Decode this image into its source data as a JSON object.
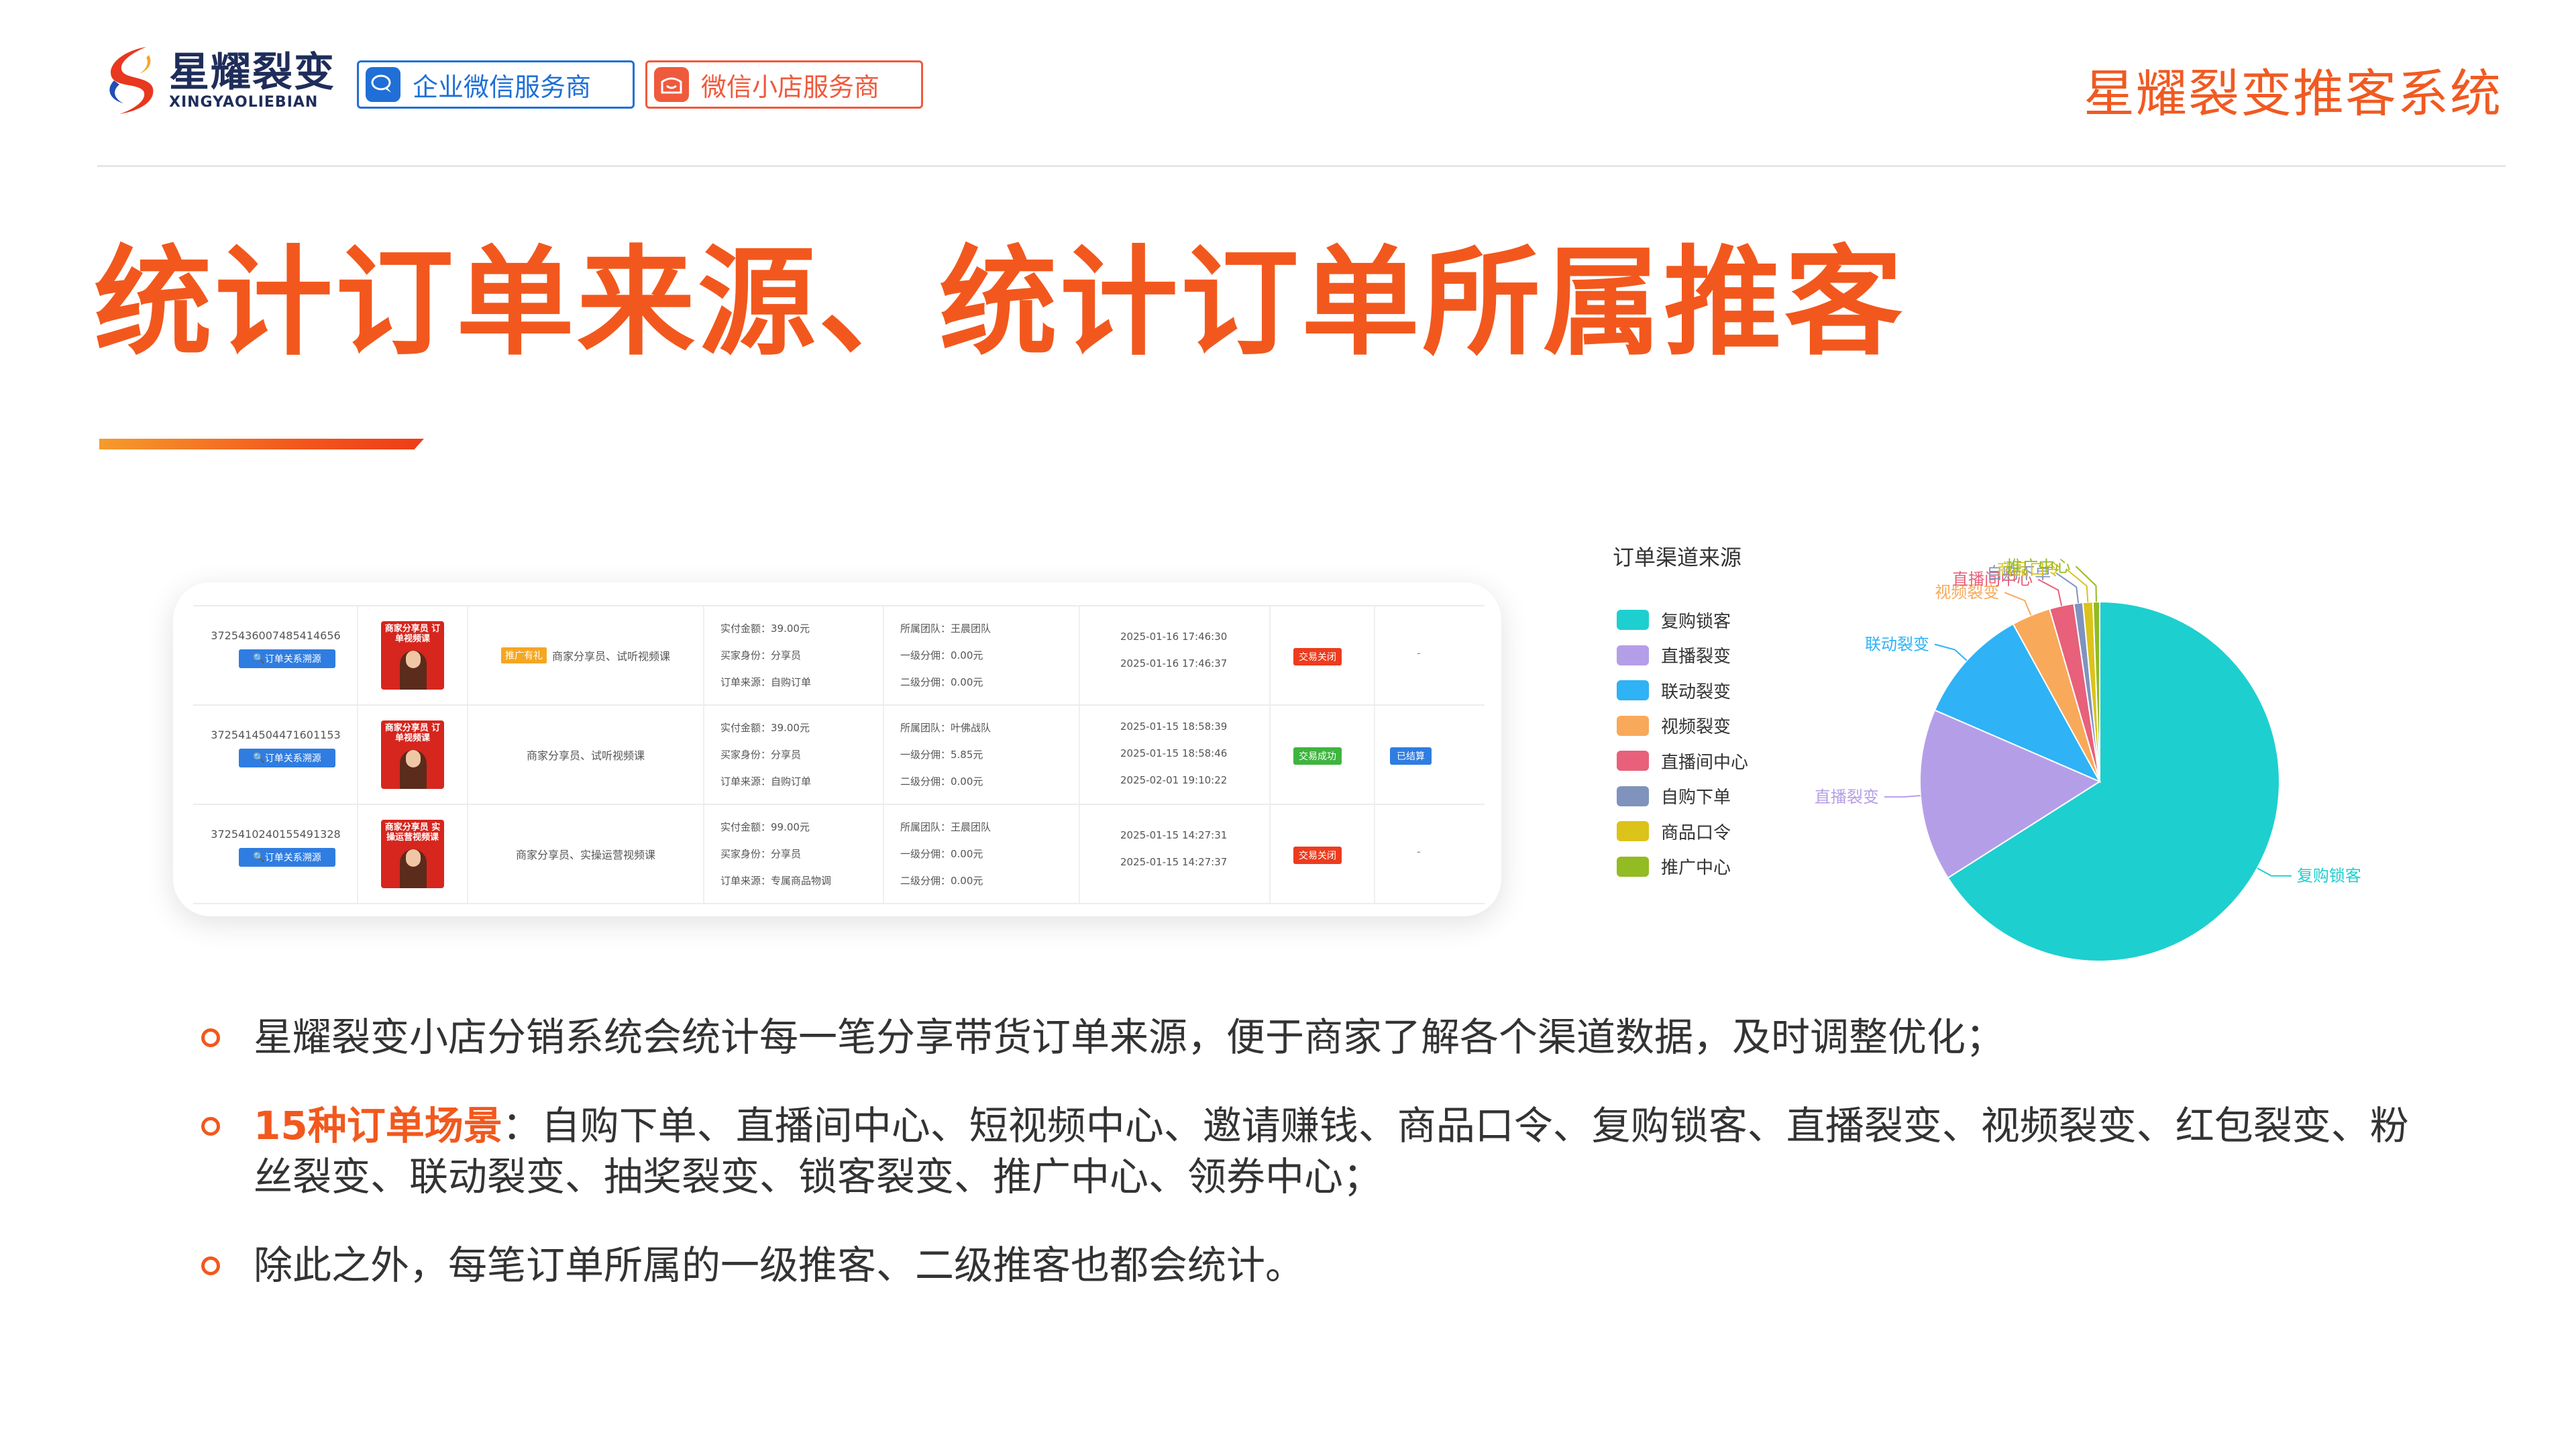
{
  "header": {
    "logo_cn": "星耀裂变",
    "logo_en": "XINGYAOLIEBIAN",
    "badge_wechat": "企业微信服务商",
    "badge_shop": "微信小店服务商",
    "brand_title": "星耀裂变推客系统"
  },
  "main_title": "统计订单来源、统计订单所属推客",
  "table": {
    "rows": [
      {
        "order_id": "3725436007485414656",
        "source_button": "订单关系溯源",
        "thumb_text": "商家分享员 订单视频课",
        "promo_tag": "推广有礼",
        "product": "商家分享员、试听视频课",
        "paid": "实付金额：39.00元",
        "buyer": "买家身份：分享员",
        "origin": "订单来源：自购订单",
        "team": "所属团队：王晨团队",
        "level1": "一级分佣：0.00元",
        "level2": "二级分佣：0.00元",
        "time1": "2025-01-16 17:46:30",
        "time2": "2025-01-16 17:46:37",
        "time3": "",
        "status": "交易关闭",
        "status_color": "#ec3c1e",
        "action": "-"
      },
      {
        "order_id": "3725414504471601153",
        "source_button": "订单关系溯源",
        "thumb_text": "商家分享员 订单视频课",
        "promo_tag": "",
        "product": "商家分享员、试听视频课",
        "paid": "实付金额：39.00元",
        "buyer": "买家身份：分享员",
        "origin": "订单来源：自购订单",
        "team": "所属团队：叶佛战队",
        "level1": "一级分佣：5.85元",
        "level2": "二级分佣：0.00元",
        "time1": "2025-01-15 18:58:39",
        "time2": "2025-01-15 18:58:46",
        "time3": "2025-02-01 19:10:22",
        "status": "交易成功",
        "status_color": "#3fb43f",
        "action": "已结算"
      },
      {
        "order_id": "3725410240155491328",
        "source_button": "订单关系溯源",
        "thumb_text": "商家分享员 实操运营视频课",
        "promo_tag": "",
        "product": "商家分享员、实操运营视频课",
        "paid": "实付金额：99.00元",
        "buyer": "买家身份：分享员",
        "origin": "订单来源：专属商品物调",
        "team": "所属团队：王晨团队",
        "level1": "一级分佣：0.00元",
        "level2": "二级分佣：0.00元",
        "time1": "2025-01-15 14:27:31",
        "time2": "2025-01-15 14:27:37",
        "time3": "",
        "status": "交易关闭",
        "status_color": "#ec3c1e",
        "action": "-"
      }
    ]
  },
  "chart_data": {
    "type": "pie",
    "title": "订单渠道来源",
    "legend_position": "left",
    "slices": [
      {
        "name": "复购锁客",
        "value": 66.0,
        "color": "#1ecfcf"
      },
      {
        "name": "直播裂变",
        "value": 15.5,
        "color": "#b59ee8"
      },
      {
        "name": "联动裂变",
        "value": 10.5,
        "color": "#2fb2f6"
      },
      {
        "name": "视频裂变",
        "value": 3.5,
        "color": "#f9a95a"
      },
      {
        "name": "直播间中心",
        "value": 2.2,
        "color": "#e8607a"
      },
      {
        "name": "自购下单",
        "value": 0.8,
        "color": "#7f93bd"
      },
      {
        "name": "商品口令",
        "value": 0.9,
        "color": "#dcc31a"
      },
      {
        "name": "推广中心",
        "value": 0.6,
        "color": "#93bb22"
      }
    ]
  },
  "bullets": [
    {
      "highlight": "",
      "text": "星耀裂变小店分销系统会统计每一笔分享带货订单来源，便于商家了解各个渠道数据，及时调整优化；"
    },
    {
      "highlight": "15种订单场景",
      "text": "：自购下单、直播间中心、短视频中心、邀请赚钱、商品口令、复购锁客、直播裂变、视频裂变、红包裂变、粉丝裂变、联动裂变、抽奖裂变、锁客裂变、推广中心、领券中心；"
    },
    {
      "highlight": "",
      "text": "除此之外，每笔订单所属的一级推客、二级推客也都会统计。"
    }
  ]
}
